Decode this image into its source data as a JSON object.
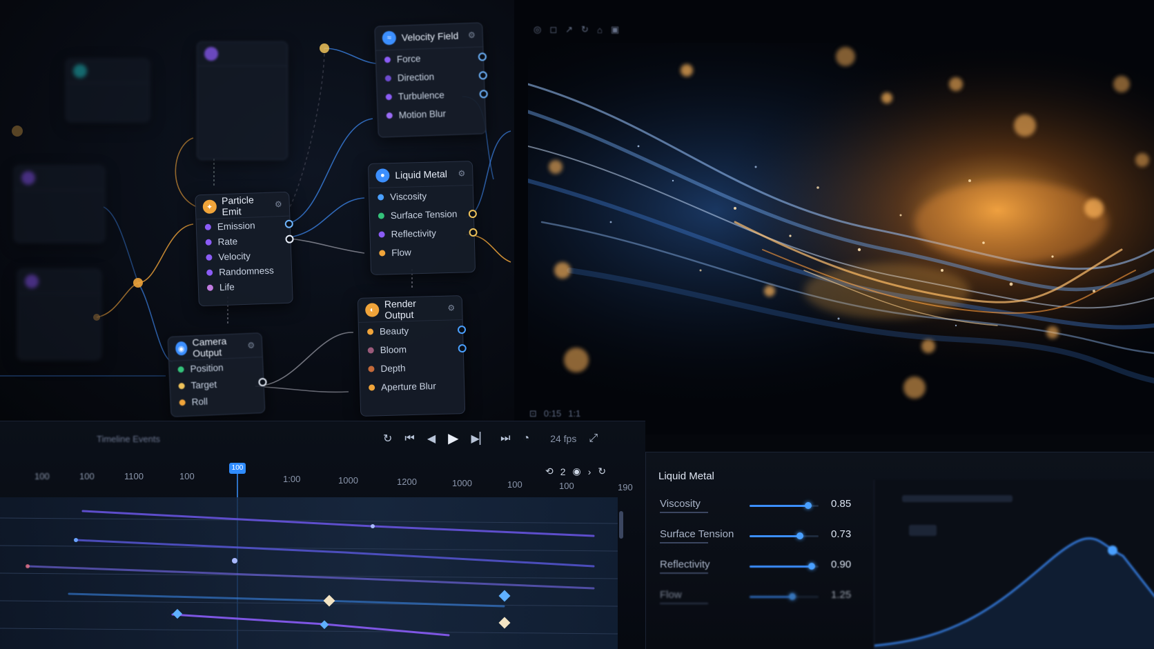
{
  "colors": {
    "accent_blue": "#3c8fff",
    "accent_orange": "#f0a43a",
    "accent_purple": "#8b5cf6",
    "accent_green": "#34c27a",
    "panel_bg": "#161c28"
  },
  "graph": {
    "nodes": {
      "velocity_field": {
        "title": "Velocity Field",
        "icon": "wind-icon",
        "ports": [
          "Force",
          "Direction",
          "Turbulence",
          "Motion Blur"
        ]
      },
      "liquid_metal": {
        "title": "Liquid Metal",
        "icon": "droplet-icon",
        "ports": [
          "Viscosity",
          "Surface Tension",
          "Reflectivity",
          "Flow"
        ]
      },
      "particle_emit": {
        "title": "Particle Emit",
        "icon": "spark-icon",
        "ports": [
          "Emission",
          "Rate",
          "Velocity",
          "Randomness",
          "Life"
        ]
      },
      "render_output": {
        "title": "Render Output",
        "icon": "render-icon",
        "ports": [
          "Beauty",
          "Bloom",
          "Depth",
          "Aperture Blur"
        ]
      },
      "camera_output": {
        "title": "Camera Output",
        "icon": "camera-icon",
        "ports": [
          "Position",
          "Target",
          "Roll"
        ]
      }
    }
  },
  "viewport": {
    "toolbar": [
      "◎",
      "◻",
      "↗",
      "↻",
      "⌂",
      "▣"
    ],
    "status": [
      "⊡",
      "0:15",
      "1:1"
    ]
  },
  "timeline": {
    "tab_label": "Timeline Events",
    "fps": "24 fps",
    "playhead": "100",
    "ruler": [
      "100",
      "100",
      "1100",
      "100",
      "1:00",
      "1000",
      "1200",
      "1000",
      "100",
      "100",
      "190"
    ],
    "tools": [
      "⟲",
      "2",
      "◉",
      "›",
      "↻"
    ]
  },
  "properties": {
    "title": "Liquid Metal",
    "rows": [
      {
        "label": "Viscosity",
        "value": "0.85",
        "level": 0.85
      },
      {
        "label": "Surface Tension",
        "value": "0.73",
        "level": 0.73
      },
      {
        "label": "Reflectivity",
        "value": "0.90",
        "level": 0.9
      },
      {
        "label": "Flow",
        "value": "1.25",
        "level": 0.62
      }
    ]
  }
}
